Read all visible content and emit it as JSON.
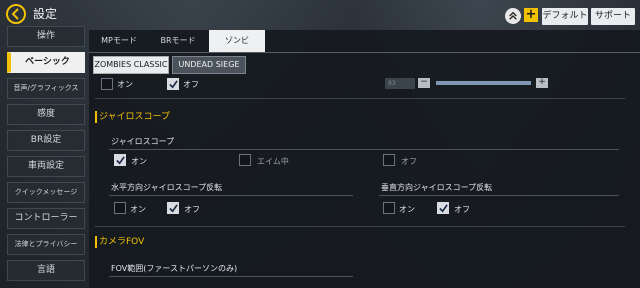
{
  "header": {
    "title": "設定",
    "default_label": "デフォルト",
    "support_label": "サポート",
    "plus_label": "+"
  },
  "sidebar": {
    "items": [
      {
        "label": "操作"
      },
      {
        "label": "ベーシック"
      },
      {
        "label": "音声/グラフィックス"
      },
      {
        "label": "感度"
      },
      {
        "label": "BR設定"
      },
      {
        "label": "車両設定"
      },
      {
        "label": "クイックメッセージ"
      },
      {
        "label": "コントローラー"
      },
      {
        "label": "法律とプライバシー"
      },
      {
        "label": "言語"
      }
    ]
  },
  "tabs": [
    {
      "label": "MPモード"
    },
    {
      "label": "BRモード"
    },
    {
      "label": "ゾンビ"
    }
  ],
  "subtabs": [
    {
      "label": "ZOMBIES CLASSIC"
    },
    {
      "label": "UNDEAD SIEGE"
    }
  ],
  "top_row": {
    "on_label": "オン",
    "off_label": "オフ",
    "slider_value": "83",
    "minus_label": "−",
    "plus_label": "+"
  },
  "gyro_section": {
    "heading": "ジャイロスコープ",
    "gyro": {
      "title": "ジャイロスコープ",
      "on_label": "オン",
      "aim_label": "エイム中",
      "off_label": "オフ"
    },
    "horizontal": {
      "title": "水平方向ジャイロスコープ反転",
      "on_label": "オン",
      "off_label": "オフ"
    },
    "vertical": {
      "title": "垂直方向ジャイロスコープ反転",
      "on_label": "オン",
      "off_label": "オフ"
    }
  },
  "camera_section": {
    "heading": "カメラFOV",
    "fov_title": "FOV範囲(ファーストパーソンのみ)"
  },
  "colors": {
    "accent": "#f2c200",
    "panel": "#16191e"
  }
}
